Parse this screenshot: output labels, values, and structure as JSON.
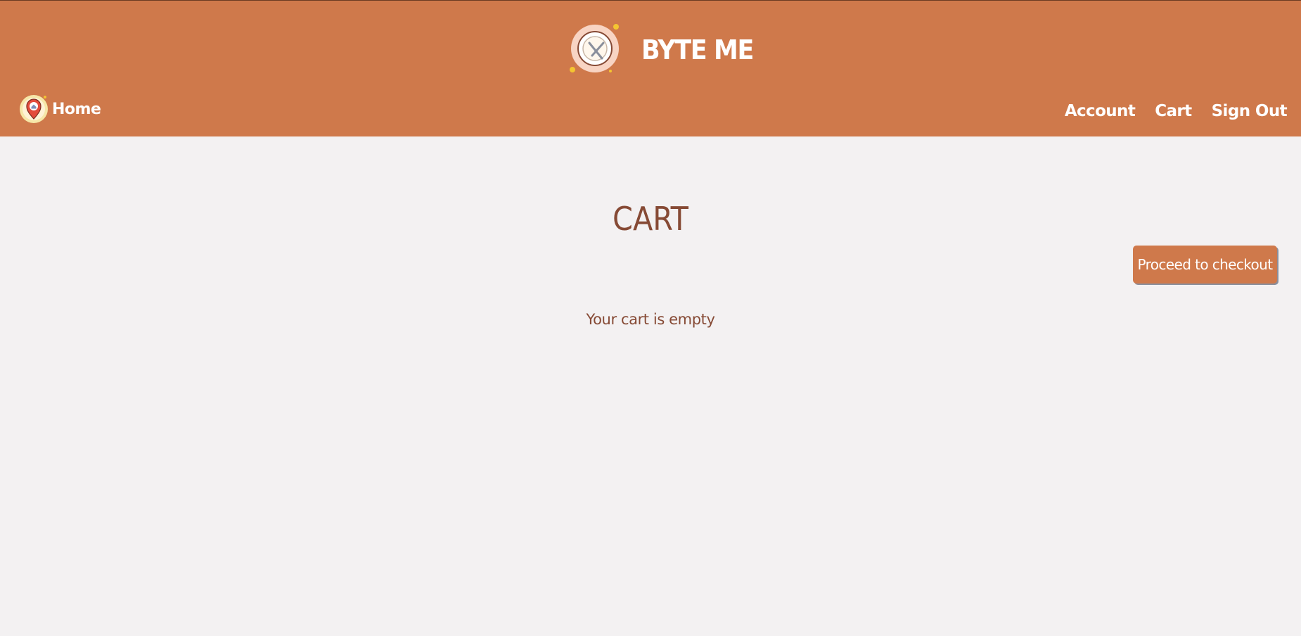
{
  "header": {
    "brand_name": "BYTE ME",
    "brand_icon": "plate-fork-knife-icon",
    "bg_color": "#cf794b",
    "home": {
      "label": "Home",
      "icon": "location-pin-home-icon"
    },
    "nav": [
      {
        "label": "Account"
      },
      {
        "label": "Cart"
      },
      {
        "label": "Sign Out"
      }
    ]
  },
  "main": {
    "title": "CART",
    "checkout_label": "Proceed to checkout",
    "empty_message": "Your cart is empty",
    "text_color": "#864a35",
    "bg_color": "#f3f1f2"
  }
}
